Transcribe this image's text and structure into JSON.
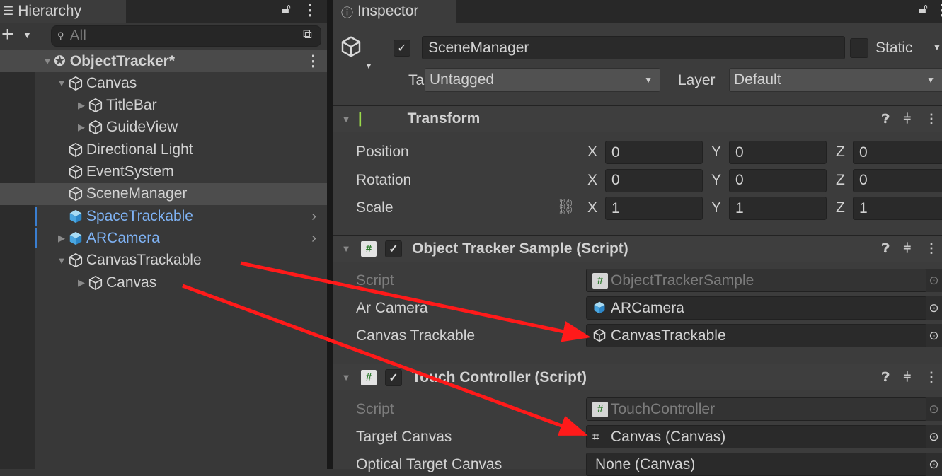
{
  "hierarchy": {
    "title": "Hierarchy",
    "search_placeholder": "All",
    "items": [
      {
        "label": "ObjectTracker*",
        "depth": 0,
        "expanded": true,
        "type": "scene"
      },
      {
        "label": "Canvas",
        "depth": 1,
        "expanded": true
      },
      {
        "label": "TitleBar",
        "depth": 2,
        "expanded": false
      },
      {
        "label": "GuideView",
        "depth": 2,
        "expanded": false
      },
      {
        "label": "Directional Light",
        "depth": 1
      },
      {
        "label": "EventSystem",
        "depth": 1
      },
      {
        "label": "SceneManager",
        "depth": 1,
        "selected": true
      },
      {
        "label": "SpaceTrackable",
        "depth": 1,
        "prefab": true
      },
      {
        "label": "ARCamera",
        "depth": 1,
        "prefab": true,
        "expanded": false
      },
      {
        "label": "CanvasTrackable",
        "depth": 1,
        "expanded": true
      },
      {
        "label": "Canvas",
        "depth": 2,
        "expanded": false
      }
    ]
  },
  "inspector": {
    "title": "Inspector",
    "object_name": "SceneManager",
    "active": true,
    "static_label": "Static",
    "static": false,
    "tag_label": "Tag",
    "tag": "Untagged",
    "layer_label": "Layer",
    "layer": "Default",
    "transform": {
      "title": "Transform",
      "rows": [
        {
          "label": "Position",
          "x": "0",
          "y": "0",
          "z": "0"
        },
        {
          "label": "Rotation",
          "x": "0",
          "y": "0",
          "z": "0"
        },
        {
          "label": "Scale",
          "x": "1",
          "y": "1",
          "z": "1"
        }
      ]
    },
    "axis": {
      "x": "X",
      "y": "Y",
      "z": "Z"
    },
    "components": [
      {
        "title": "Object Tracker Sample (Script)",
        "fields": [
          {
            "label": "Script",
            "value": "ObjectTrackerSample",
            "icon": "script-icon"
          },
          {
            "label": "Ar Camera",
            "value": "ARCamera",
            "icon": "prefab-icon"
          },
          {
            "label": "Canvas Trackable",
            "value": "CanvasTrackable",
            "icon": "gameobject-icon"
          }
        ]
      },
      {
        "title": "Touch Controller (Script)",
        "fields": [
          {
            "label": "Script",
            "value": "TouchController",
            "icon": "script-icon"
          },
          {
            "label": "Target Canvas",
            "value": "Canvas (Canvas)",
            "icon": "canvas-icon"
          },
          {
            "label": "Optical Target Canvas",
            "value": "None (Canvas)"
          }
        ]
      }
    ]
  },
  "colors": {
    "accent_blue": "#3a7ed0",
    "annotation_arrow": "#ff1a1a"
  }
}
